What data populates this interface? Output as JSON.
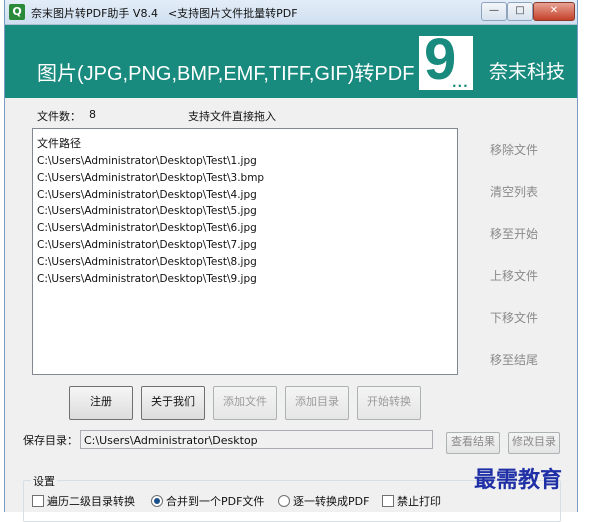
{
  "window": {
    "title": "奈末图片转PDF助手 V8.4",
    "subtitle": "<支持图片文件批量转PDF",
    "controls": {
      "minimize": "—",
      "maximize": "□",
      "close": "✕"
    }
  },
  "banner": {
    "title": "图片(JPG,PNG,BMP,EMF,TIFF,GIF)转PDF",
    "logo_digit": "9",
    "logo_dots": "...",
    "brand": "奈末科技",
    "color": "#188a7e"
  },
  "info": {
    "count_label": "文件数：",
    "count_value": "8",
    "drag_hint": "支持文件直接拖入"
  },
  "file_list": {
    "header": "文件路径",
    "rows": [
      "C:\\Users\\Administrator\\Desktop\\Test\\1.jpg",
      "C:\\Users\\Administrator\\Desktop\\Test\\3.bmp",
      "C:\\Users\\Administrator\\Desktop\\Test\\4.jpg",
      "C:\\Users\\Administrator\\Desktop\\Test\\5.jpg",
      "C:\\Users\\Administrator\\Desktop\\Test\\6.jpg",
      "C:\\Users\\Administrator\\Desktop\\Test\\7.jpg",
      "C:\\Users\\Administrator\\Desktop\\Test\\8.jpg",
      "C:\\Users\\Administrator\\Desktop\\Test\\9.jpg"
    ]
  },
  "side_actions": {
    "remove": "移除文件",
    "clear": "清空列表",
    "move_to_start": "移至开始",
    "move_up": "上移文件",
    "move_down": "下移文件",
    "move_to_end": "移至结尾"
  },
  "actions": {
    "register": "注册",
    "about": "关于我们",
    "add_file": "添加文件",
    "add_dir": "添加目录",
    "start": "开始转换"
  },
  "save": {
    "label": "保存目录：",
    "path": "C:\\Users\\Administrator\\Desktop",
    "view_result": "查看结果",
    "change_dir": "修改目录"
  },
  "settings": {
    "title": "设置",
    "traverse_subdir": "遍历二级目录转换",
    "merge_one": "合并到一个PDF文件",
    "each_one": "逐一转换成PDF",
    "no_print": "禁止打印",
    "selected": "merge_one"
  },
  "watermark": "最需教育"
}
